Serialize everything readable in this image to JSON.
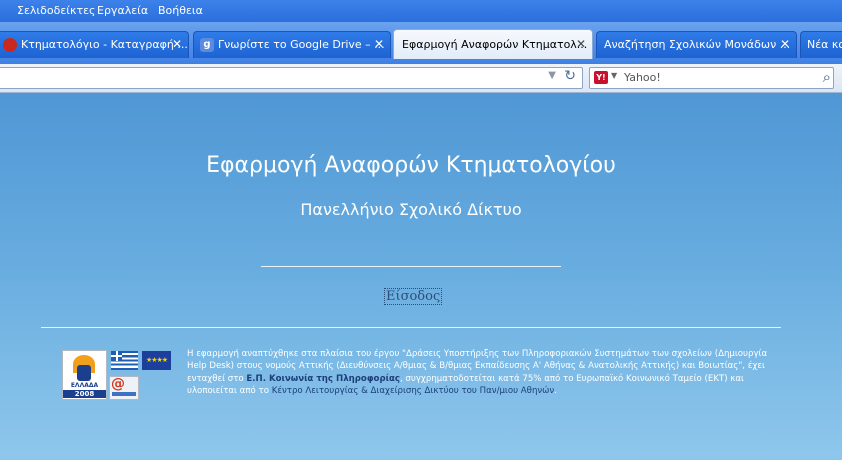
{
  "menu": {
    "items": [
      "Σελιδοδείκτες",
      "Εργαλεία",
      "Βοήθεια"
    ]
  },
  "tabs": [
    {
      "label": "Κτηματολόγιο - Καταγραφή ...",
      "active": false,
      "icon": "red-circle-icon"
    },
    {
      "label": "Γνωρίστε το Google Drive – ...",
      "active": false,
      "icon": "google-g-icon"
    },
    {
      "label": "Εφαρμογή Αναφορών Κτηματολ...",
      "active": true
    },
    {
      "label": "Αναζήτηση Σχολικών Μονάδων ...",
      "active": false
    },
    {
      "label": "Νέα καρτ",
      "active": false
    }
  ],
  "tab_close_glyph": "✕",
  "navbar": {
    "search_engine": "Y!",
    "search_placeholder": "Yahoo!"
  },
  "page": {
    "title": "Εφαρμογή Αναφορών Κτηματολογίου",
    "subtitle": "Πανελλήνιο Σχολικό Δίκτυο",
    "login_link": "Είσοδος",
    "logo_ellada_text": "ΕΛΛΑΔΑ",
    "logo_ellada_year": "2008",
    "footer": {
      "part1": "Η εφαρμογή αναπτύχθηκε στα πλαίσια του έργου \"Δράσεις Υποστήριξης των Πληροφοριακών Συστημάτων των σχολείων (Δημιουργία Help Desk) στους νομούς Αττικής (Διευθύνσεις Α/θμιας & Β/θμιας Εκπαίδευσης Α' Αθήνας & Ανατολικής Αττικής) και Βοιωτίας\", έχει ενταχθεί στο ",
      "link1": "Ε.Π. Κοινωνία της Πληροφορίας",
      "part2": ", συγχρηματοδοτείται κατά 75% από το Ευρωπαϊκό Κοινωνικό Ταμείο (ΕΚΤ) και υλοποιείται από το ",
      "link2": "Κέντρο Λειτουργίας & Διαχείρισης Δικτύου του Παν/μιου Αθηνών",
      "part3": "."
    }
  },
  "colors": {
    "menubar": "#2a6fdc",
    "content_top": "#4f97d5",
    "content_bottom": "#8fc7ec"
  }
}
